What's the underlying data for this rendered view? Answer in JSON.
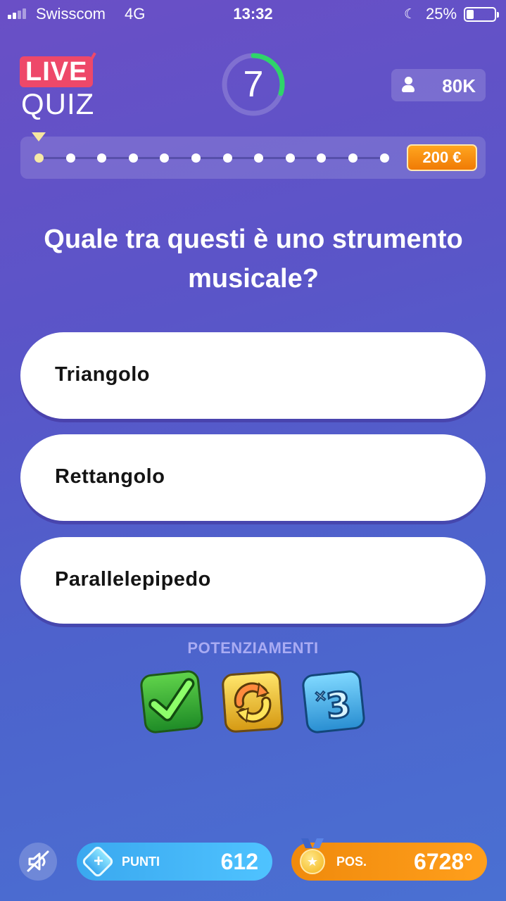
{
  "status_bar": {
    "carrier": "Swisscom",
    "network": "4G",
    "time": "13:32",
    "battery": "25%",
    "battery_level": 0.25
  },
  "header": {
    "logo_live": "LIVE",
    "logo_quiz": "QUIZ",
    "timer": "7",
    "timer_progress": 0.3,
    "players": "80K"
  },
  "progress": {
    "total_steps": 12,
    "current_step": 1,
    "prize": "200 €"
  },
  "question": {
    "text": "Quale tra questi è uno strumento musicale?"
  },
  "answers": [
    {
      "label": "Triangolo"
    },
    {
      "label": "Rettangolo"
    },
    {
      "label": "Parallelepipedo"
    }
  ],
  "powerups": {
    "title": "POTENZIAMENTI",
    "items": [
      {
        "icon": "check-powerup-icon"
      },
      {
        "icon": "swap-powerup-icon"
      },
      {
        "icon": "times-three-powerup-icon"
      }
    ]
  },
  "footer": {
    "points_label": "PUNTI",
    "points_value": "612",
    "position_label": "POS.",
    "position_value": "6728°"
  },
  "colors": {
    "accent_live": "#ee4869",
    "timer_arc": "#2fd46a",
    "prize_orange": "#f07b05",
    "points_blue": "#3aa8ef",
    "position_orange": "#f08a0c"
  }
}
